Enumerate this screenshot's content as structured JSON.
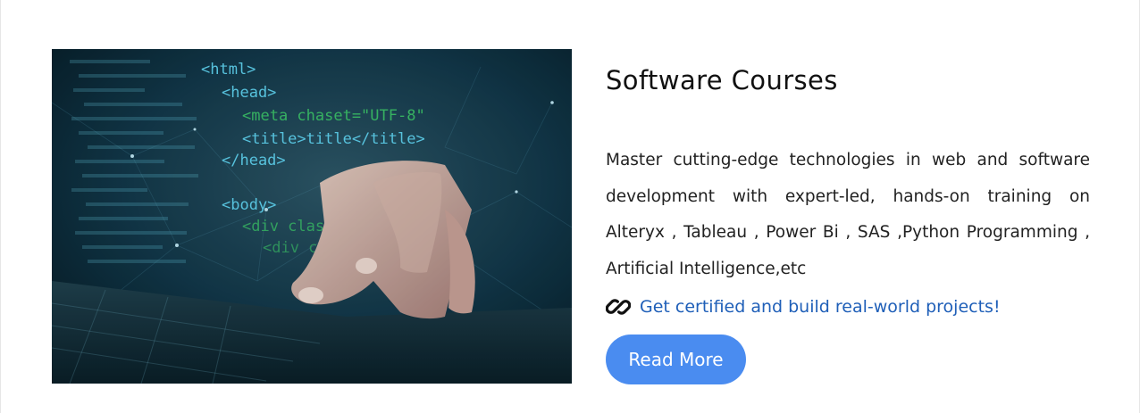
{
  "card": {
    "image": {
      "alt_subject": "hand typing on laptop with HTML code overlay",
      "code_lines": [
        "<html>",
        "<head>",
        "<meta chaset=\"UTF-8\"",
        "<title>title</title>",
        "</head>",
        "<body>",
        "<div class",
        "<div c",
        "{...}"
      ]
    },
    "title": "Software Courses",
    "description": "Master cutting-edge technologies in web and software development with expert-led, hands-on training on Alteryx , Tableau , Power Bi , SAS ,Python Programming , Artificial Intelligence,etc",
    "cert_icon": "chain-link-icon",
    "cert_text": "Get certified and build real-world projects!",
    "button_label": "Read More"
  },
  "colors": {
    "link": "#1f5fb8",
    "button": "#4a8cf0",
    "code_cyan": "#5fd3f0",
    "code_green": "#3bc06a"
  }
}
